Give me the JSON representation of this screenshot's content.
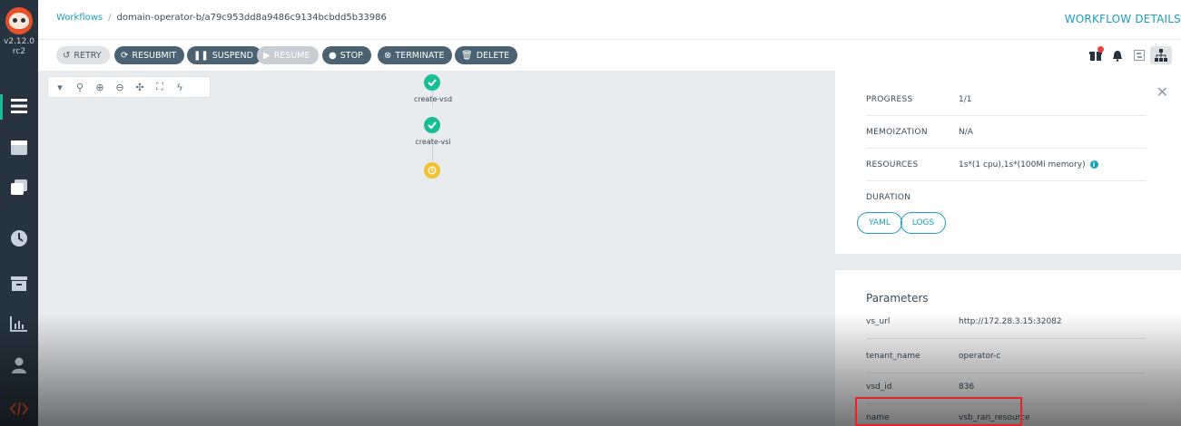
{
  "sidebar": {
    "version": "v2.12.0",
    "version_suffix": "rc2",
    "items": [
      {
        "name": "workflows",
        "icon": "list-icon"
      },
      {
        "name": "templates",
        "icon": "template-icon"
      },
      {
        "name": "cluster-templates",
        "icon": "stack-icon"
      },
      {
        "name": "cron",
        "icon": "clock-icon"
      },
      {
        "name": "archive",
        "icon": "archive-icon"
      },
      {
        "name": "reports",
        "icon": "chart-icon"
      },
      {
        "name": "user",
        "icon": "user-icon"
      },
      {
        "name": "api-docs",
        "icon": "code-icon"
      }
    ]
  },
  "header": {
    "breadcrumb_root": "Workflows",
    "breadcrumb_current": "domain-operator-b/a79c953dd8a9486c9134bcbdd5b33986",
    "title": "WORKFLOW DETAILS"
  },
  "toolbar": {
    "retry": "RETRY",
    "resubmit": "RESUBMIT",
    "suspend": "SUSPEND",
    "resume": "RESUME",
    "stop": "STOP",
    "terminate": "TERMINATE",
    "delete": "DELETE"
  },
  "graph": {
    "nodes": [
      {
        "label": "create-vsd",
        "status": "succeeded"
      },
      {
        "label": "create-vsi",
        "status": "succeeded"
      },
      {
        "label": "",
        "status": "pending"
      }
    ]
  },
  "details": {
    "progress_label": "PROGRESS",
    "progress_value": "1/1",
    "memoization_label": "MEMOIZATION",
    "memoization_value": "N/A",
    "resources_label": "RESOURCES",
    "resources_value": "1s*(1 cpu),1s*(100Mi memory)",
    "duration_label": "DURATION",
    "duration_value": "",
    "yaml_button": "YAML",
    "logs_button": "LOGS"
  },
  "parameters": {
    "title": "Parameters",
    "rows": [
      {
        "key": "vs_url",
        "value": "http://172.28.3.15:32082"
      },
      {
        "key": "tenant_name",
        "value": "operator-c"
      },
      {
        "key": "vsd_id",
        "value": "836"
      },
      {
        "key": "name",
        "value": "vsb_ran_resource"
      }
    ]
  },
  "colors": {
    "accent": "#1c9ec0",
    "success": "#18be94",
    "pending": "#f4c030",
    "sidebar": "#27343f",
    "highlight": "#e0262c"
  }
}
